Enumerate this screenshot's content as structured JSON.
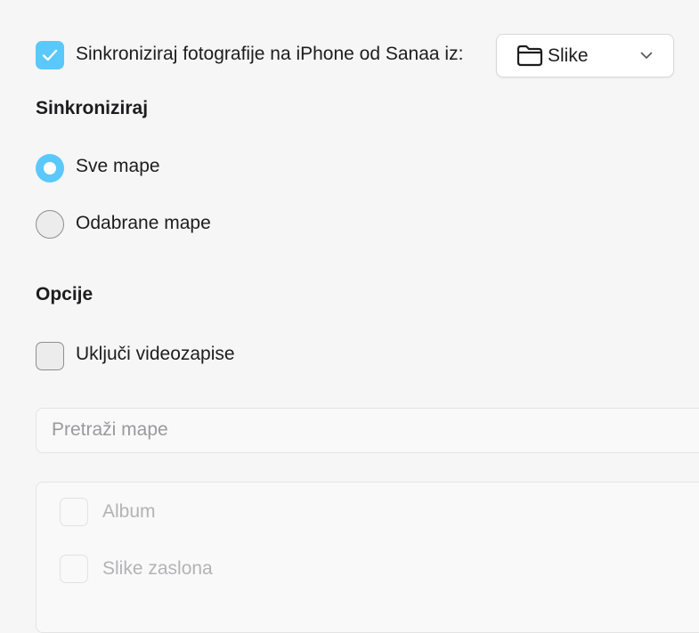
{
  "sync": {
    "checked": true,
    "label": "Sinkroniziraj fotografije na iPhone od Sanaa iz:",
    "source": {
      "value": "Slike",
      "icon": "folder-icon"
    }
  },
  "sync_section": {
    "heading": "Sinkroniziraj",
    "options": [
      {
        "label": "Sve mape",
        "selected": true
      },
      {
        "label": "Odabrane mape",
        "selected": false
      }
    ]
  },
  "options_section": {
    "heading": "Opcije",
    "include_videos": {
      "label": "Uključi videozapise",
      "checked": false
    }
  },
  "search": {
    "placeholder": "Pretraži mape"
  },
  "folders": [
    {
      "label": "Album",
      "checked": false,
      "enabled": false
    },
    {
      "label": "Slike zaslona",
      "checked": false,
      "enabled": false
    }
  ],
  "colors": {
    "accent": "#5ac8fa",
    "background": "#f6f6f6",
    "disabled_text": "#b3b3b6"
  }
}
